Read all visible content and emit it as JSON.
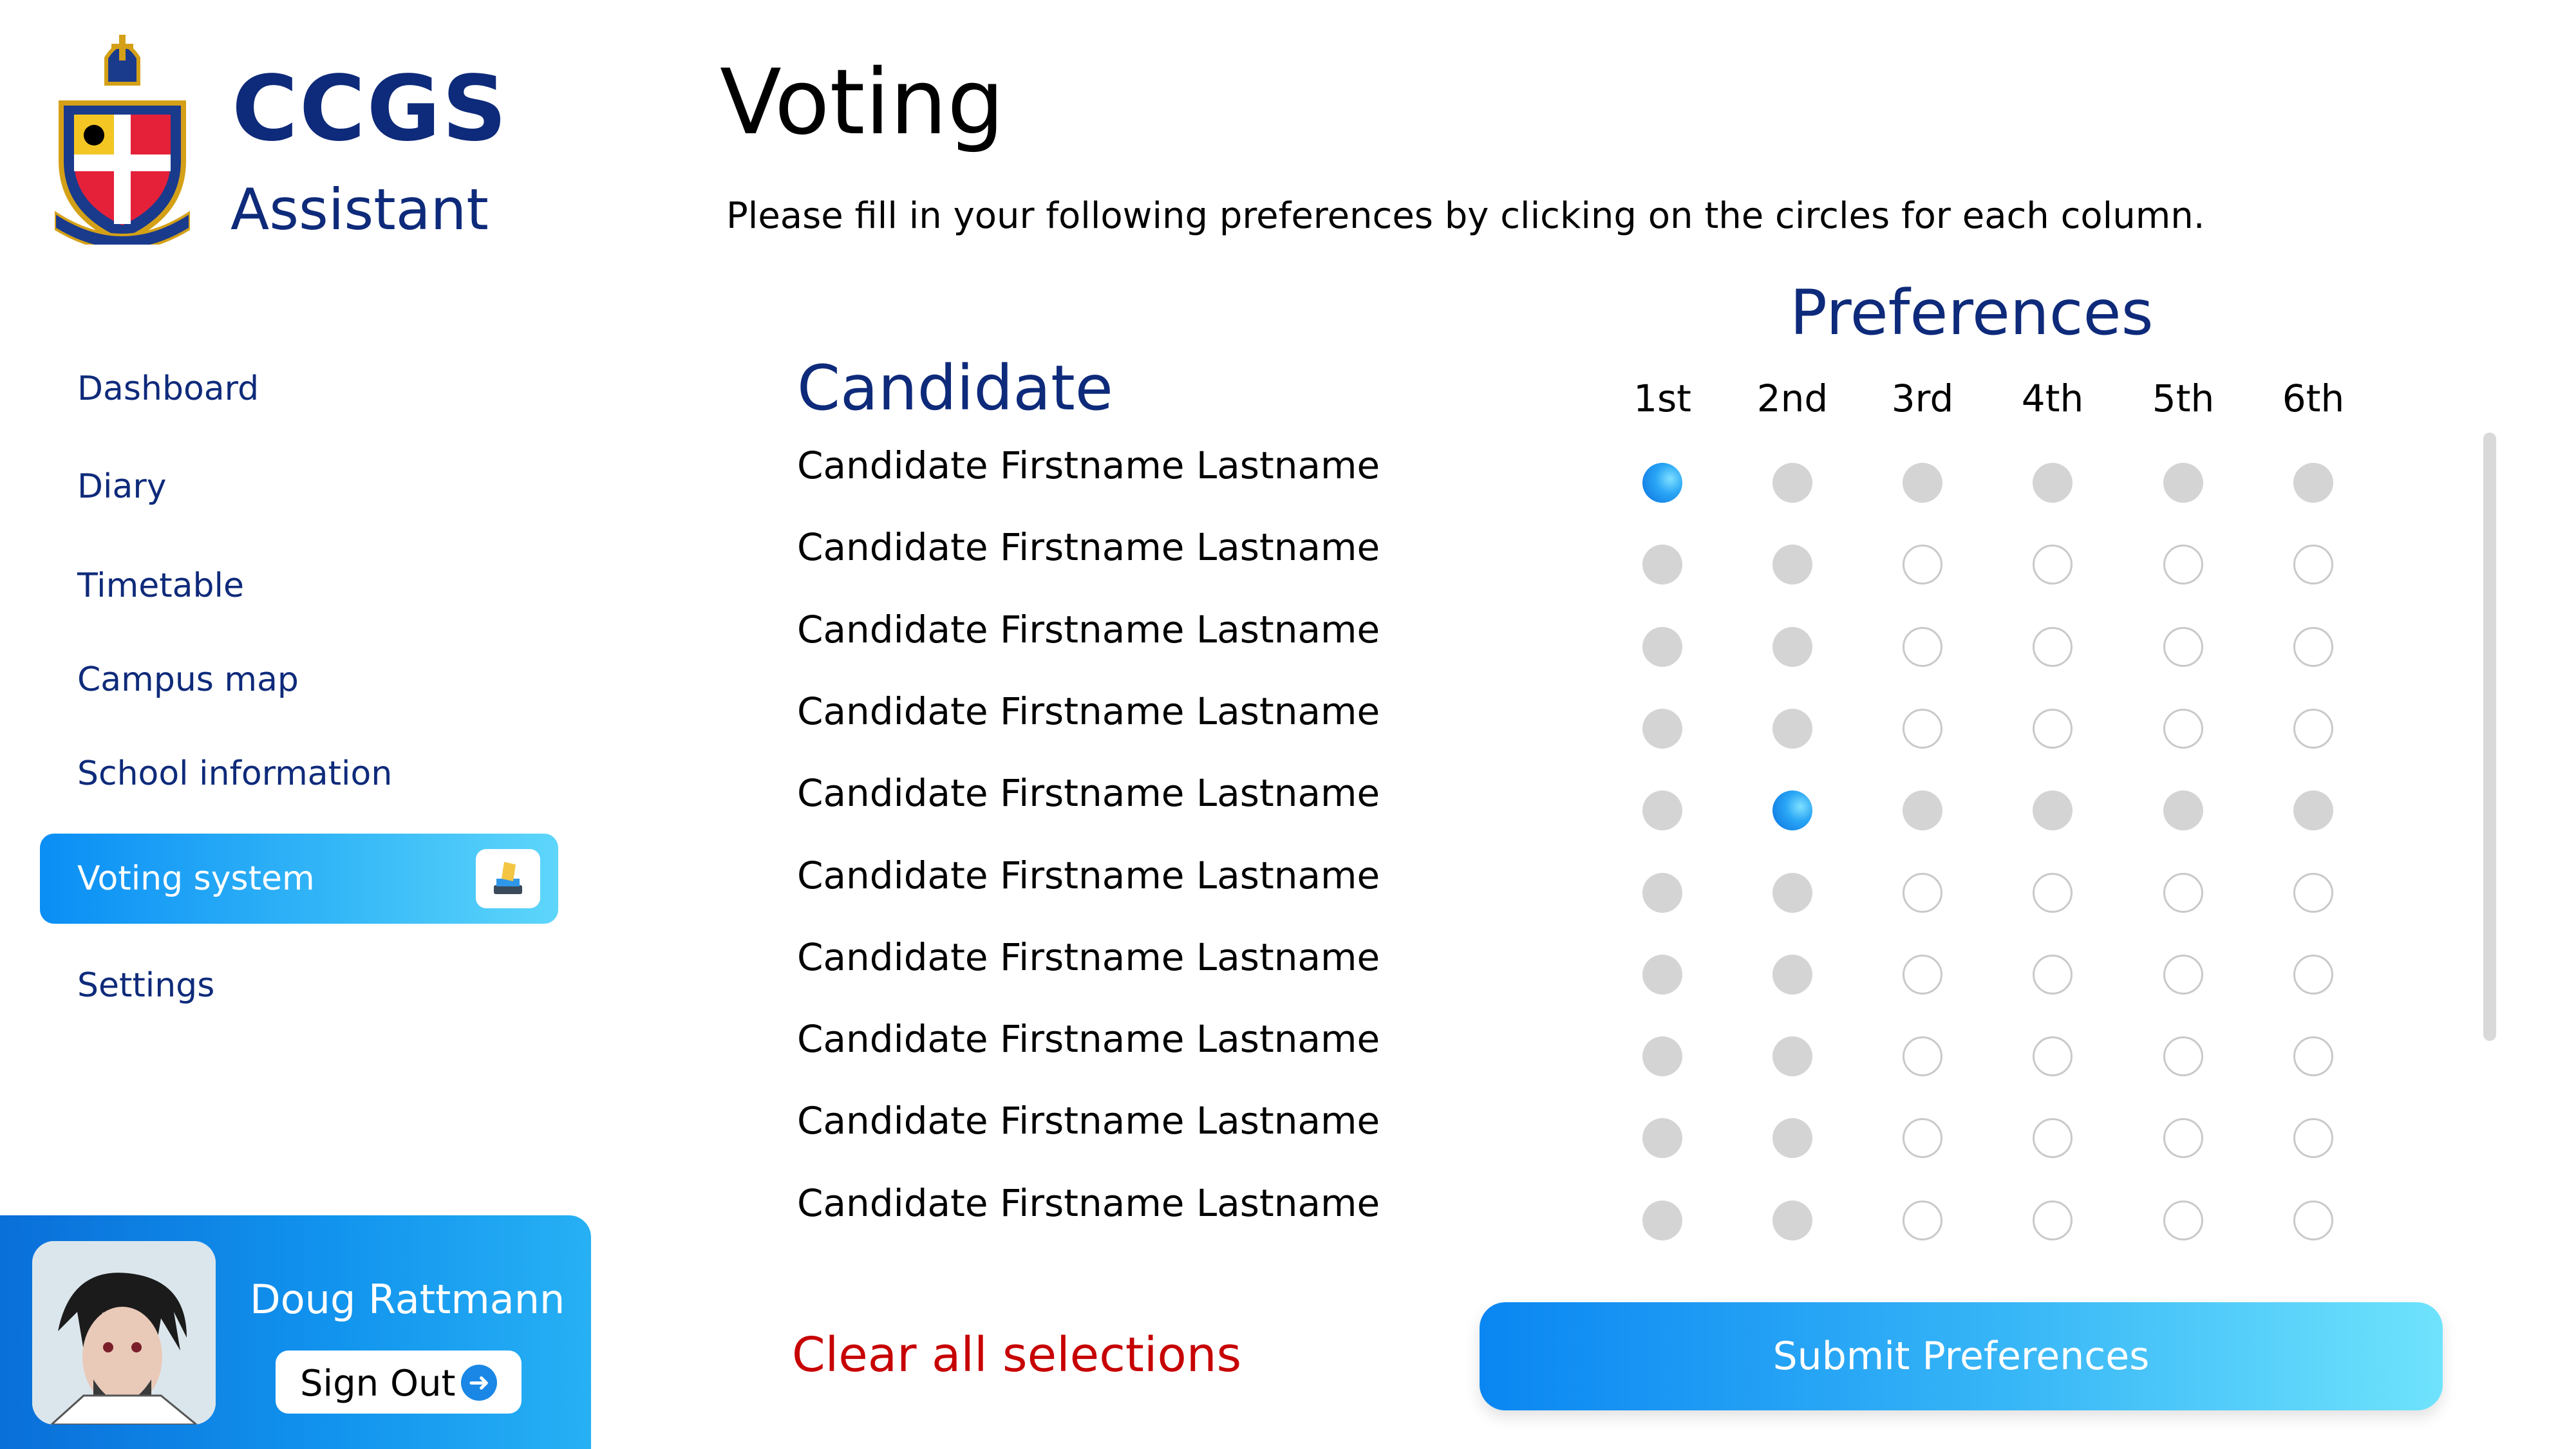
{
  "brand": {
    "title": "CCGS",
    "subtitle": "Assistant"
  },
  "sidebar": {
    "items": [
      {
        "label": "Dashboard",
        "active": false
      },
      {
        "label": "Diary",
        "active": false
      },
      {
        "label": "Timetable",
        "active": false
      },
      {
        "label": "Campus map",
        "active": false
      },
      {
        "label": "School information",
        "active": false
      },
      {
        "label": "Voting system",
        "active": true,
        "icon": "ballot-box-icon"
      },
      {
        "label": "Settings",
        "active": false
      }
    ]
  },
  "user": {
    "name": "Doug Rattmann",
    "sign_out_label": "Sign Out",
    "sign_out_icon": "arrow-right-circle-icon"
  },
  "main": {
    "title": "Voting",
    "instructions": "Please fill in your following preferences by clicking on the circles for each column.",
    "preferences_heading": "Preferences",
    "candidate_heading": "Candidate",
    "columns": [
      "1st",
      "2nd",
      "3rd",
      "4th",
      "5th",
      "6th"
    ],
    "candidates": [
      {
        "name": "Candidate Firstname Lastname",
        "states": [
          "selected",
          "blocked",
          "blocked",
          "blocked",
          "blocked",
          "blocked"
        ]
      },
      {
        "name": "Candidate Firstname Lastname",
        "states": [
          "blocked",
          "blocked",
          "open",
          "open",
          "open",
          "open"
        ]
      },
      {
        "name": "Candidate Firstname Lastname",
        "states": [
          "blocked",
          "blocked",
          "open",
          "open",
          "open",
          "open"
        ]
      },
      {
        "name": "Candidate Firstname Lastname",
        "states": [
          "blocked",
          "blocked",
          "open",
          "open",
          "open",
          "open"
        ]
      },
      {
        "name": "Candidate Firstname Lastname",
        "states": [
          "blocked",
          "selected",
          "blocked",
          "blocked",
          "blocked",
          "blocked"
        ]
      },
      {
        "name": "Candidate Firstname Lastname",
        "states": [
          "blocked",
          "blocked",
          "open",
          "open",
          "open",
          "open"
        ]
      },
      {
        "name": "Candidate Firstname Lastname",
        "states": [
          "blocked",
          "blocked",
          "open",
          "open",
          "open",
          "open"
        ]
      },
      {
        "name": "Candidate Firstname Lastname",
        "states": [
          "blocked",
          "blocked",
          "open",
          "open",
          "open",
          "open"
        ]
      },
      {
        "name": "Candidate Firstname Lastname",
        "states": [
          "blocked",
          "blocked",
          "open",
          "open",
          "open",
          "open"
        ]
      },
      {
        "name": "Candidate Firstname Lastname",
        "states": [
          "blocked",
          "blocked",
          "open",
          "open",
          "open",
          "open"
        ]
      }
    ],
    "clear_label": "Clear all selections",
    "submit_label": "Submit Preferences"
  },
  "colors": {
    "brand_navy": "#0e2a7a",
    "accent_blue": "#0a8ef5",
    "clear_red": "#c70000",
    "blocked_grey": "#d4d4d4"
  }
}
